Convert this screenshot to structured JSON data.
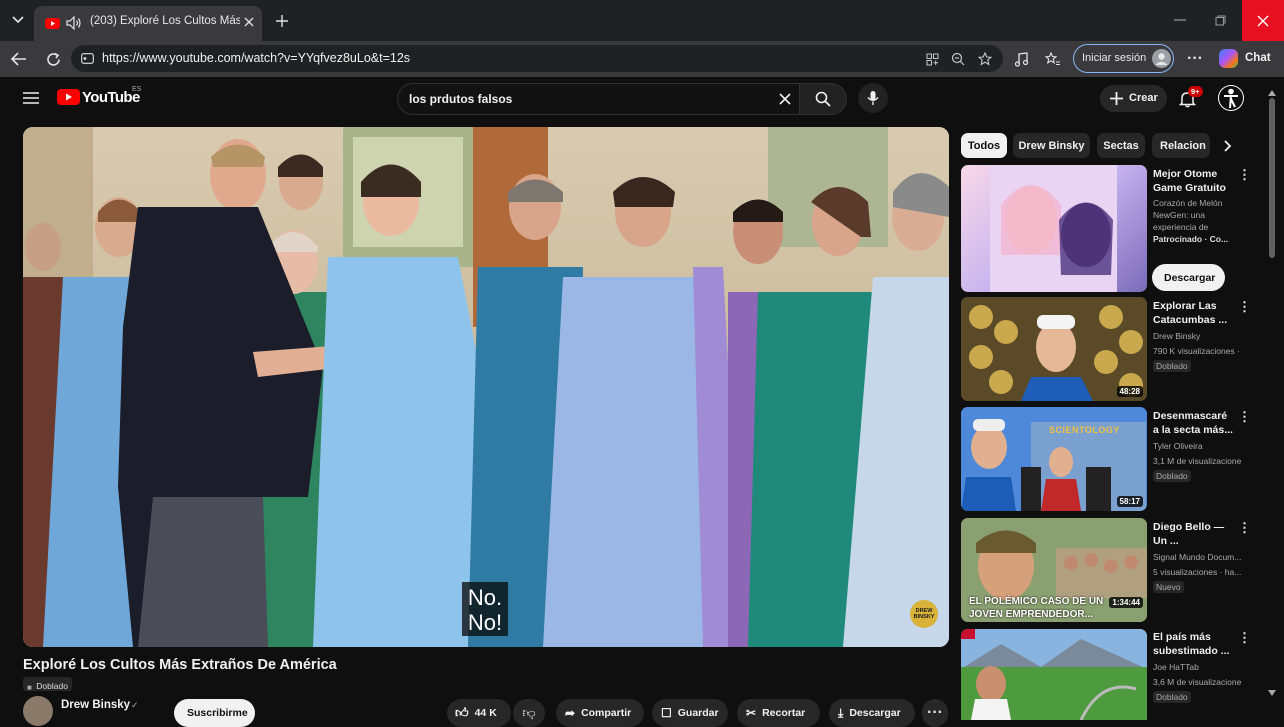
{
  "browser": {
    "tab_title": "(203) Exploré Los Cultos Más",
    "url": "https://www.youtube.com/watch?v=YYqfvez8uLo&t=12s",
    "signin_label": "Iniciar sesión",
    "chat_label": "Chat"
  },
  "youtube": {
    "logo_text": "YouTube",
    "region": "ES",
    "search_value": "los prdutos falsos",
    "create_label": "Crear",
    "notification_count": "9+"
  },
  "video": {
    "subtitle_line1": "No.",
    "subtitle_line2": "No!",
    "watermark": "DREW BINSKY",
    "title": "Exploré Los Cultos Más Extraños De América",
    "dubbed": "Doblado",
    "channel": "Drew Binsky",
    "subscribe_label": "Suscribirme",
    "likes": "44 K",
    "share_label": "Compartir",
    "save_label": "Guardar",
    "clip_label": "Recortar",
    "download_label": "Descargar"
  },
  "chips": [
    "Todos",
    "Drew Binsky",
    "Sectas",
    "Relacion"
  ],
  "recommendations": [
    {
      "title_1": "Mejor Otome",
      "title_2": "Game Gratuito",
      "meta_1": "Corazón de Melón",
      "meta_2": "NewGen: una",
      "meta_3": "experiencia de",
      "meta_4": "Patrocinado · Co...",
      "cta": "Descargar"
    },
    {
      "title_1": "Explorar Las",
      "title_2": "Catacumbas ...",
      "channel": "Drew Binsky",
      "views": "790 K visualizaciones ·",
      "tag": "Doblado",
      "duration": "48:28"
    },
    {
      "title_1": "Desenmascaré",
      "title_2": "a la secta más...",
      "channel": "Tyler Oliveira",
      "views": "3,1 M de visualizacione",
      "tag": "Doblado",
      "duration": "58:17",
      "thumb_text": "SCIENTOLOGY"
    },
    {
      "title_1": "Diego Bello —",
      "title_2": "Un ...",
      "channel": "Signal Mundo Docum...",
      "views": "5 visualizaciones · ha...",
      "tag": "Nuevo",
      "duration": "1:34:44",
      "thumb_text_1": "EL POLÉMICO CASO DE UN",
      "thumb_text_2": "JOVEN EMPRENDEDOR..."
    },
    {
      "title_1": "El país más",
      "title_2": "subestimado ...",
      "channel": "Joe HaTTab",
      "views": "3,6 M de visualizacione",
      "tag": "Doblado"
    }
  ],
  "colors": {
    "youtube_red": "#ff0000",
    "close_red": "#e81123",
    "page_bg": "#0f0f0f"
  }
}
